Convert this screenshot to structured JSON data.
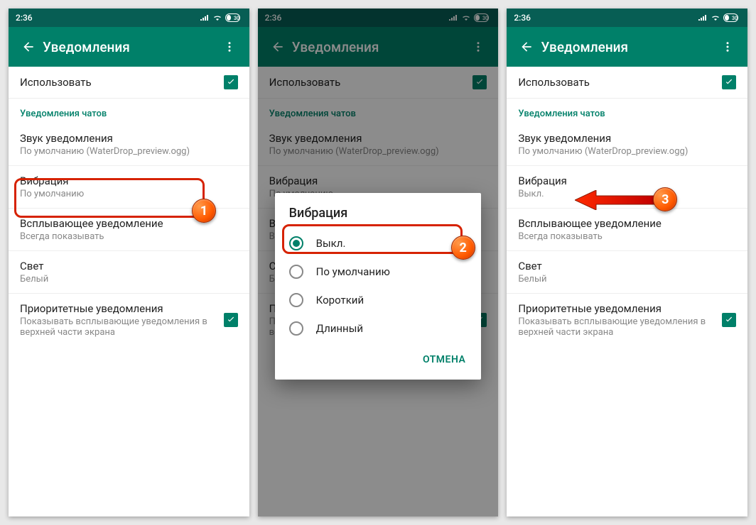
{
  "status": {
    "time": "2:36",
    "battery": "30"
  },
  "appbar": {
    "title": "Уведомления"
  },
  "rows": {
    "use": "Использовать",
    "section": "Уведомления чатов",
    "sound_title": "Звук уведомления",
    "sound_sub": "По умолчанию (WaterDrop_preview.ogg)",
    "vibe_title": "Вибрация",
    "vibe_sub_default": "По умолчанию",
    "vibe_sub_off": "Выкл.",
    "popup_title": "Всплывающее уведомление",
    "popup_sub": "Всегда показывать",
    "light_title": "Свет",
    "light_sub": "Белый",
    "prio_title": "Приоритетные уведомления",
    "prio_sub": "Показывать всплывающие уведомления в верхней части экрана"
  },
  "dialog": {
    "title": "Вибрация",
    "opts": [
      "Выкл.",
      "По умолчанию",
      "Короткий",
      "Длинный"
    ],
    "cancel": "ОТМЕНА"
  },
  "annotations": {
    "b1": "1",
    "b2": "2",
    "b3": "3"
  }
}
